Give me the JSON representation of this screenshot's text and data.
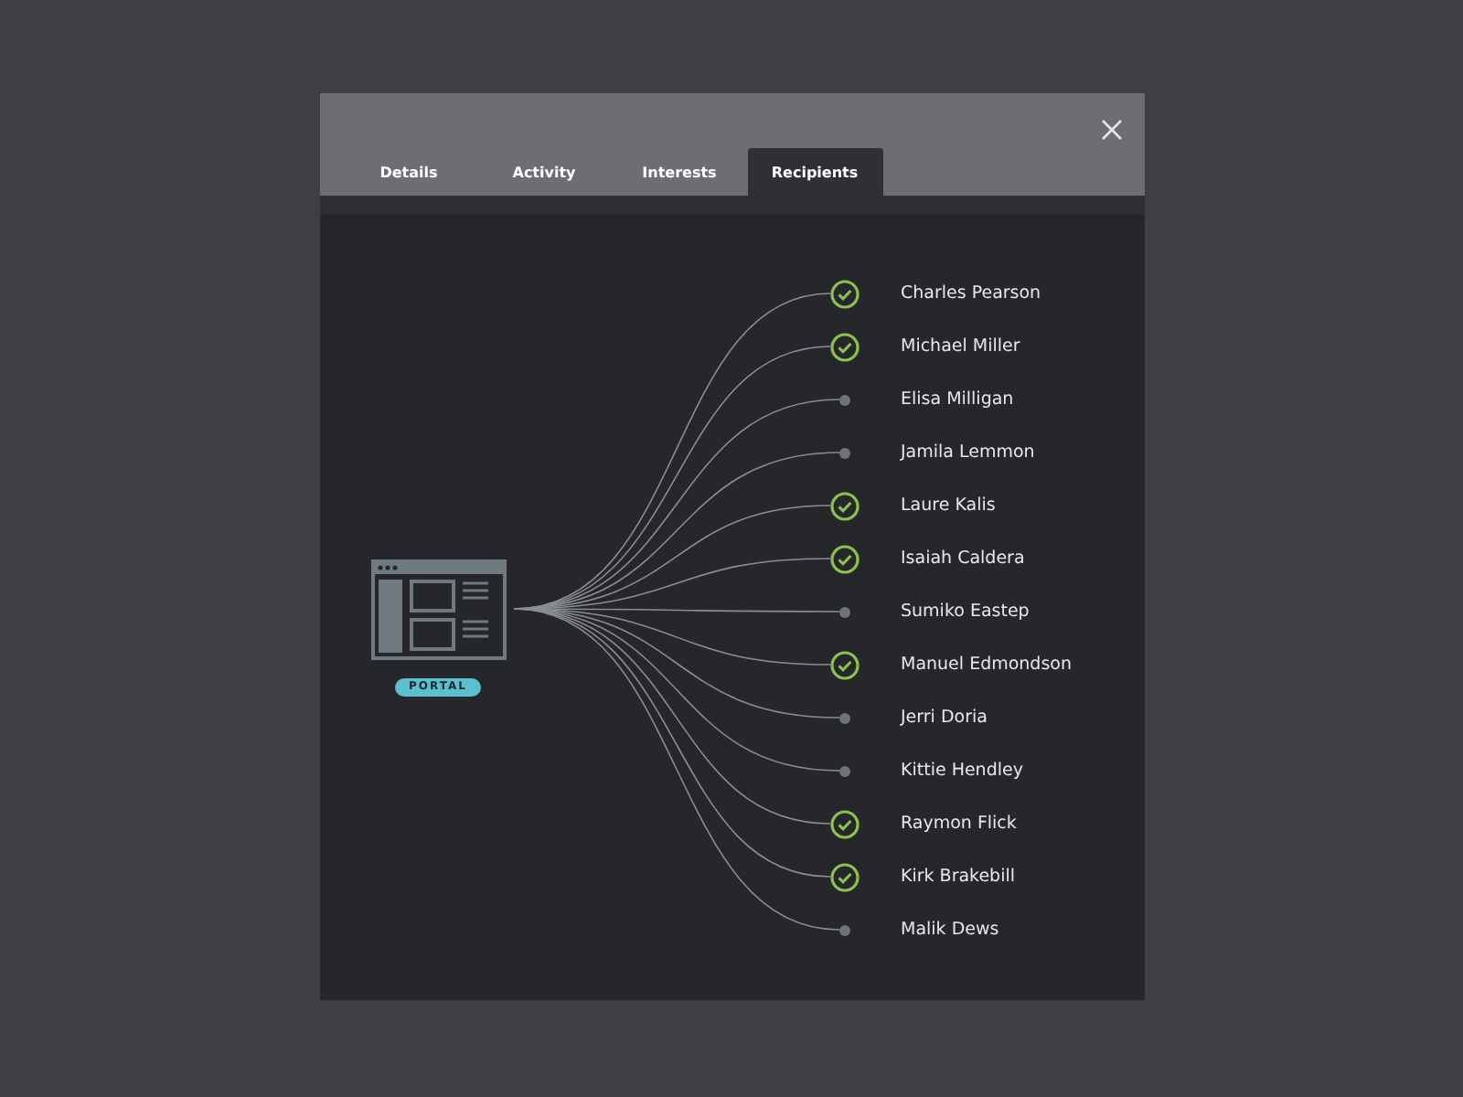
{
  "tabs": [
    {
      "label": "Details",
      "selected": false
    },
    {
      "label": "Activity",
      "selected": false
    },
    {
      "label": "Interests",
      "selected": false
    },
    {
      "label": "Recipients",
      "selected": true
    }
  ],
  "portal": {
    "badge": "PORTAL"
  },
  "recipients": [
    {
      "name": "Charles Pearson",
      "checked": true
    },
    {
      "name": "Michael Miller",
      "checked": true
    },
    {
      "name": "Elisa Milligan",
      "checked": false
    },
    {
      "name": "Jamila Lemmon",
      "checked": false
    },
    {
      "name": "Laure Kalis",
      "checked": true
    },
    {
      "name": "Isaiah Caldera",
      "checked": true
    },
    {
      "name": "Sumiko Eastep",
      "checked": false
    },
    {
      "name": "Manuel Edmondson",
      "checked": true
    },
    {
      "name": "Jerri Doria",
      "checked": false
    },
    {
      "name": "Kittie Hendley",
      "checked": false
    },
    {
      "name": "Raymon Flick",
      "checked": true
    },
    {
      "name": "Kirk Brakebill",
      "checked": true
    },
    {
      "name": "Malik Dews",
      "checked": false
    }
  ]
}
